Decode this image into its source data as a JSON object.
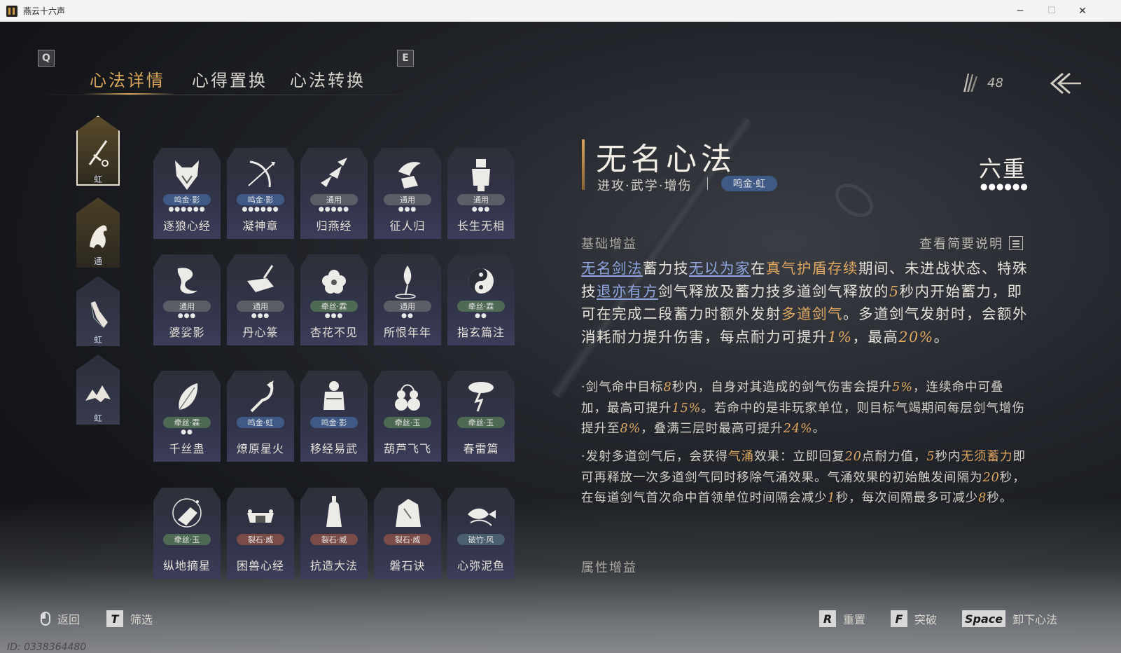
{
  "window": {
    "title": "燕云十六声",
    "minimize": "─",
    "maximize": "☐",
    "close": "✕"
  },
  "tabs": {
    "left_key": "Q",
    "right_key": "E",
    "items": [
      {
        "label": "心法详情",
        "active": true
      },
      {
        "label": "心得置换",
        "active": false
      },
      {
        "label": "心法转换",
        "active": false
      }
    ]
  },
  "currency": {
    "icon": "feather-bundle-icon",
    "value": "48"
  },
  "categories": [
    {
      "icon": "sword-tassel-icon",
      "label": "虹",
      "selected": true
    },
    {
      "icon": "horse-icon",
      "label": "通",
      "selected": false
    },
    {
      "icon": "fan-hand-icon",
      "label": "虹",
      "selected": false
    },
    {
      "icon": "mountains-icon",
      "label": "虹",
      "selected": false
    }
  ],
  "skills": [
    {
      "name": "逐狼心经",
      "tag": "鸣金·影",
      "tag_type": "mjy",
      "dots": "●●●●●●",
      "icon": "wolf-icon"
    },
    {
      "name": "凝神章",
      "tag": "鸣金·影",
      "tag_type": "mjy",
      "dots": "●●●●●●",
      "icon": "bow-icon"
    },
    {
      "name": "归燕经",
      "tag": "通用",
      "tag_type": "ty",
      "dots": "●●●●●",
      "icon": "swallows-icon"
    },
    {
      "name": "征人归",
      "tag": "通用",
      "tag_type": "ty",
      "dots": "●●●",
      "icon": "bird-hand-icon"
    },
    {
      "name": "长生无相",
      "tag": "通用",
      "tag_type": "ty",
      "dots": "●●●",
      "icon": "armor-figure-icon"
    },
    {
      "name": "婆娑影",
      "tag": "通用",
      "tag_type": "ty",
      "dots": "●●●",
      "icon": "dragon-icon"
    },
    {
      "name": "丹心篆",
      "tag": "通用",
      "tag_type": "ty",
      "dots": "●●●",
      "icon": "brush-icon"
    },
    {
      "name": "杏花不见",
      "tag": "牵丝·霖",
      "tag_type": "qs",
      "dots": "●●●",
      "icon": "apricot-flower-icon"
    },
    {
      "name": "所恨年年",
      "tag": "通用",
      "tag_type": "ty",
      "dots": "●●",
      "icon": "lotus-icon"
    },
    {
      "name": "指玄篇注",
      "tag": "牵丝·霖",
      "tag_type": "qs",
      "dots": "●●",
      "icon": "yin-yang-icon"
    },
    {
      "name": "千丝蛊",
      "tag": "牵丝·霖",
      "tag_type": "qs",
      "dots": "●●",
      "icon": "leaf-icon"
    },
    {
      "name": "燎原星火",
      "tag": "鸣金·虹",
      "tag_type": "mjy",
      "dots": "",
      "icon": "spear-icon"
    },
    {
      "name": "移经易武",
      "tag": "鸣金·影",
      "tag_type": "mjy",
      "dots": "",
      "icon": "warrior-icon"
    },
    {
      "name": "葫芦飞飞",
      "tag": "牵丝·玉",
      "tag_type": "qs",
      "dots": "",
      "icon": "gourd-icon"
    },
    {
      "name": "春雷篇",
      "tag": "牵丝·玉",
      "tag_type": "qs",
      "dots": "",
      "icon": "lightning-tree-icon"
    },
    {
      "name": "纵地摘星",
      "tag": "牵丝·玉",
      "tag_type": "qs",
      "dots": "",
      "icon": "star-fan-icon"
    },
    {
      "name": "困兽心经",
      "tag": "裂石·威",
      "tag_type": "ls",
      "dots": "",
      "icon": "collar-icon"
    },
    {
      "name": "抗造大法",
      "tag": "裂石·威",
      "tag_type": "ls",
      "dots": "",
      "icon": "bell-icon"
    },
    {
      "name": "磐石诀",
      "tag": "裂石·威",
      "tag_type": "ls",
      "dots": "",
      "icon": "rock-icon"
    },
    {
      "name": "心弥泥鱼",
      "tag": "破竹·风",
      "tag_type": "zf",
      "dots": "",
      "icon": "fish-icon"
    }
  ],
  "detail": {
    "title": "无名心法",
    "tags": "进攻·武学·增伤",
    "school": "鸣金·虹",
    "rank": "六重",
    "rank_dots": "●●●●●●",
    "section_basic": "基础增益",
    "brief_link": "查看简要说明",
    "section_attr": "属性增益",
    "para1": [
      {
        "t": "无名剑法",
        "c": "link"
      },
      {
        "t": "蓄力技",
        "c": ""
      },
      {
        "t": "无以为家",
        "c": "link"
      },
      {
        "t": "在",
        "c": ""
      },
      {
        "t": "真气护盾存续",
        "c": "gold"
      },
      {
        "t": "期间、未进战状态、特殊技",
        "c": ""
      },
      {
        "t": "退亦有方",
        "c": "link"
      },
      {
        "t": "剑气释放及蓄力技多道剑气释放的",
        "c": ""
      },
      {
        "t": "5",
        "c": "num"
      },
      {
        "t": "秒内开始蓄力，即可在完成二段蓄力时额外发射",
        "c": ""
      },
      {
        "t": "多道剑气",
        "c": "gold"
      },
      {
        "t": "。多道剑气发射时，会额外消耗耐力提升伤害，每点耐力可提升",
        "c": ""
      },
      {
        "t": "1%",
        "c": "num"
      },
      {
        "t": "，最高",
        "c": ""
      },
      {
        "t": "20%",
        "c": "num"
      },
      {
        "t": "。",
        "c": ""
      }
    ],
    "para2": [
      {
        "t": "·剑气命中目标",
        "c": ""
      },
      {
        "t": "8",
        "c": "num"
      },
      {
        "t": "秒内，自身对其造成的剑气伤害会提升",
        "c": ""
      },
      {
        "t": "5%",
        "c": "num"
      },
      {
        "t": "，连续命中可叠加，最高可提升",
        "c": ""
      },
      {
        "t": "15%",
        "c": "num"
      },
      {
        "t": "。若命中的是非玩家单位，则目标气竭期间每层剑气增伤提升至",
        "c": ""
      },
      {
        "t": "8%",
        "c": "num"
      },
      {
        "t": "，叠满三层时最高可提升",
        "c": ""
      },
      {
        "t": "24%",
        "c": "num"
      },
      {
        "t": "。",
        "c": ""
      }
    ],
    "para3": [
      {
        "t": "·发射多道剑气后，会获得",
        "c": ""
      },
      {
        "t": "气涌",
        "c": "gold"
      },
      {
        "t": "效果：立即回复",
        "c": ""
      },
      {
        "t": "20",
        "c": "num"
      },
      {
        "t": "点耐力值，",
        "c": ""
      },
      {
        "t": "5",
        "c": "num"
      },
      {
        "t": "秒内",
        "c": ""
      },
      {
        "t": "无须蓄力",
        "c": "gold"
      },
      {
        "t": "即可再释放一次多道剑气同时移除气涌效果。气涌效果的初始触发间隔为",
        "c": ""
      },
      {
        "t": "20",
        "c": "num"
      },
      {
        "t": "秒，在每道剑气首次命中首领单位时间隔会减少",
        "c": ""
      },
      {
        "t": "1",
        "c": "num"
      },
      {
        "t": "秒，每次间隔最多可减少",
        "c": ""
      },
      {
        "t": "8",
        "c": "num"
      },
      {
        "t": "秒。",
        "c": ""
      }
    ]
  },
  "bottom": {
    "back_label": "返回",
    "filter_key": "T",
    "filter_label": "筛选",
    "reset_key": "R",
    "reset_label": "重置",
    "break_key": "F",
    "break_label": "突破",
    "unequip_key": "Space",
    "unequip_label": "卸下心法"
  },
  "player_id": "ID: 0338364480",
  "colors": {
    "accent": "#d8a45a",
    "link": "#8fa6e0",
    "number": "#e0a860"
  }
}
